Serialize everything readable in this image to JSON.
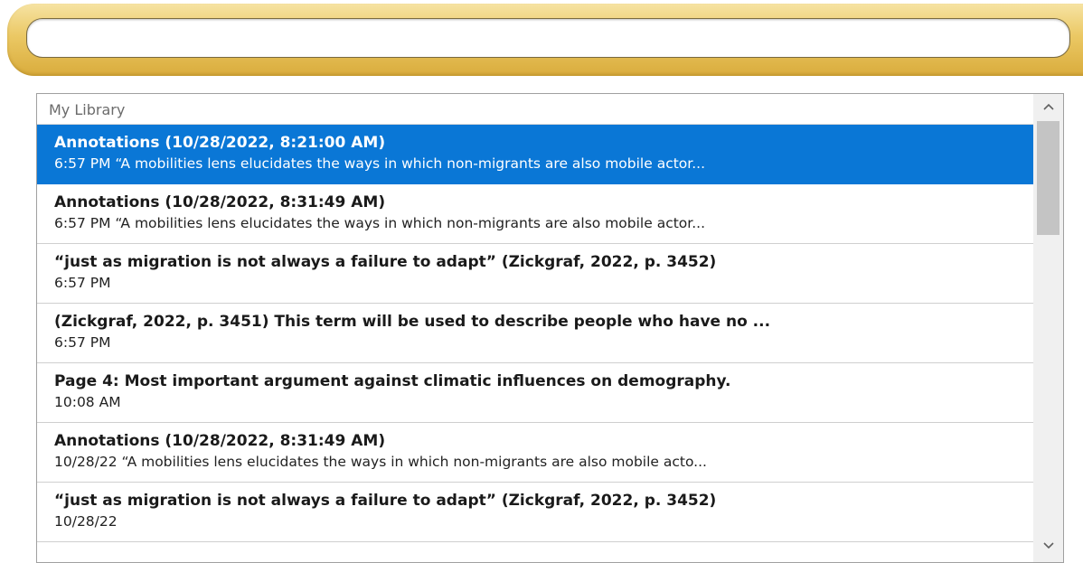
{
  "search": {
    "value": "",
    "placeholder": ""
  },
  "library": {
    "header": "My Library",
    "items": [
      {
        "title": "Annotations (10/28/2022, 8:21:00 AM)",
        "subtitle": "6:57 PM “A mobilities lens elucidates the ways in which non-migrants are also mobile actor...",
        "selected": true
      },
      {
        "title": "Annotations (10/28/2022, 8:31:49 AM)",
        "subtitle": "6:57 PM “A mobilities lens elucidates the ways in which non-migrants are also mobile actor...",
        "selected": false
      },
      {
        "title": "“just as migration is not always a failure to adapt” (Zickgraf, 2022, p. 3452)",
        "subtitle": "6:57 PM",
        "selected": false
      },
      {
        "title": "(Zickgraf, 2022, p. 3451) This term will be used to describe people who have no ...",
        "subtitle": "6:57 PM",
        "selected": false
      },
      {
        "title": "Page 4: Most important argument against climatic influences on demography.",
        "subtitle": "10:08 AM",
        "selected": false
      },
      {
        "title": "Annotations (10/28/2022, 8:31:49 AM)",
        "subtitle": "10/28/22 “A mobilities lens elucidates the ways in which non-migrants are also mobile acto...",
        "selected": false
      },
      {
        "title": "“just as migration is not always a failure to adapt” (Zickgraf, 2022, p. 3452)",
        "subtitle": "10/28/22",
        "selected": false
      }
    ]
  },
  "scrollbar": {
    "up_icon": "chevron-up-icon",
    "down_icon": "chevron-down-icon"
  },
  "colors": {
    "band_gold": "#e3bd55",
    "selection_blue": "#0a77d6"
  }
}
